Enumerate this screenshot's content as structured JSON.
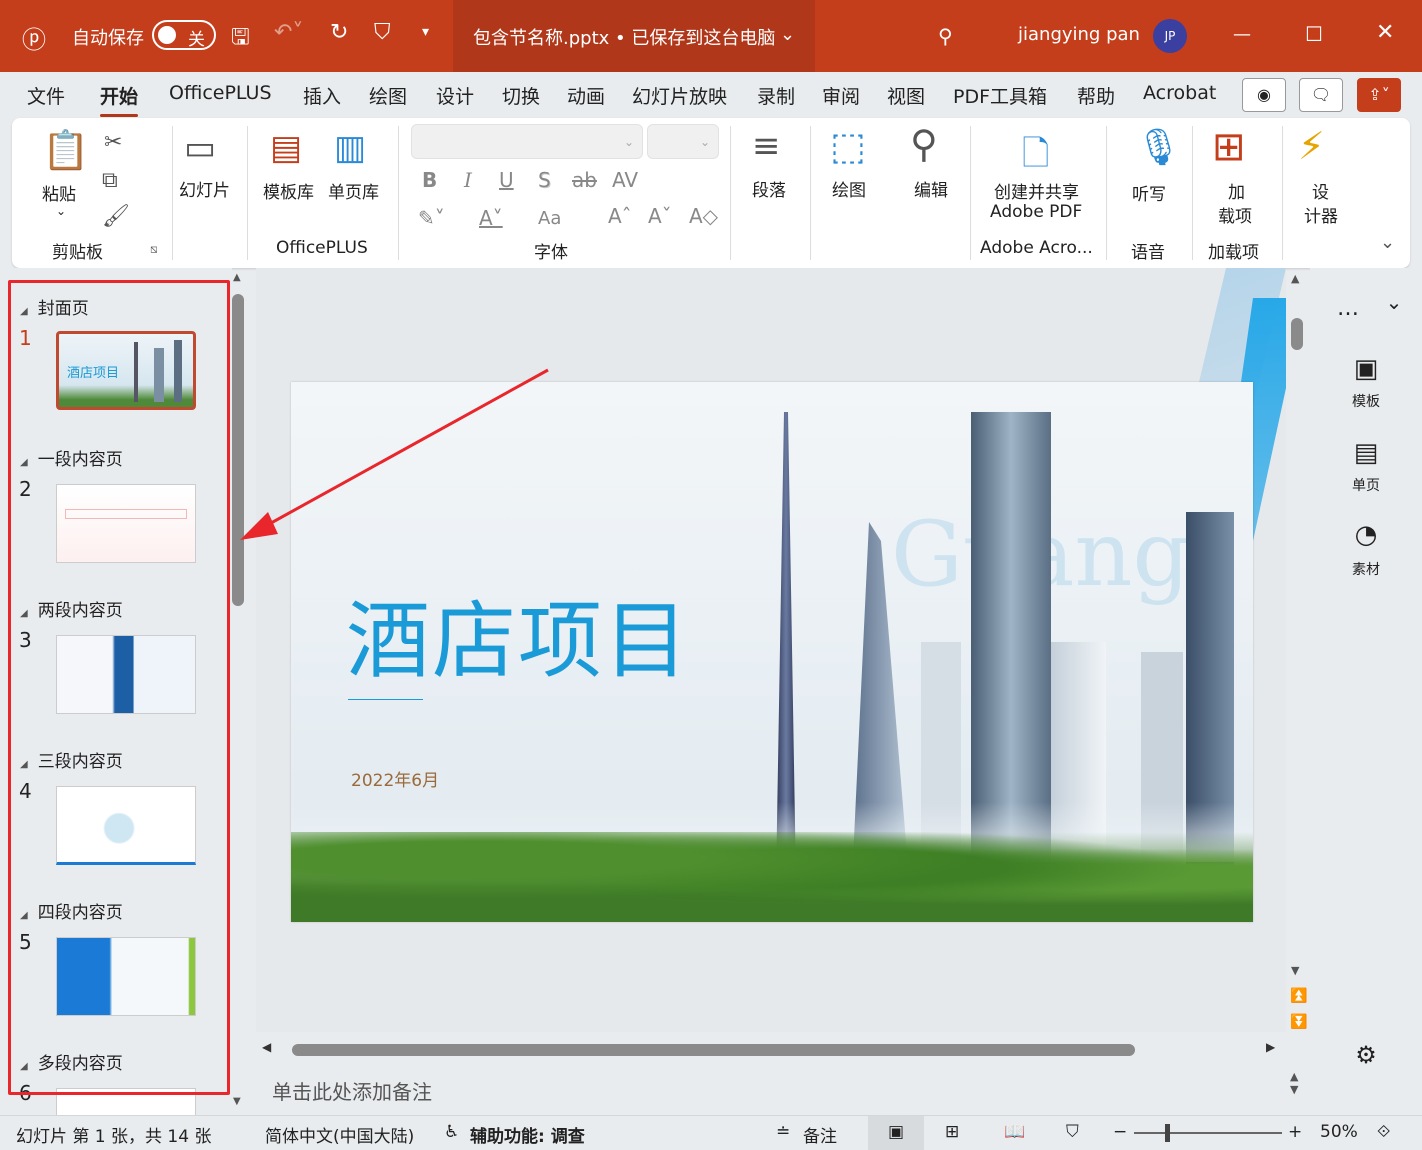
{
  "titlebar": {
    "autosave_label": "自动保存",
    "autosave_state": "关",
    "document_title": "包含节名称.pptx • 已保存到这台电脑",
    "user_name": "jiangying pan",
    "user_initials": "JP"
  },
  "tabs": [
    "文件",
    "开始",
    "OfficePLUS",
    "插入",
    "绘图",
    "设计",
    "切换",
    "动画",
    "幻灯片放映",
    "录制",
    "审阅",
    "视图",
    "PDF工具箱",
    "帮助",
    "Acrobat"
  ],
  "ribbon": {
    "clipboard": {
      "paste": "粘贴",
      "group": "剪贴板"
    },
    "slides": {
      "slide": "幻灯片"
    },
    "officeplus": {
      "template_lib": "模板库",
      "page_lib": "单页库",
      "group": "OfficePLUS"
    },
    "font": {
      "group": "字体",
      "bold": "B",
      "italic": "I",
      "underline": "U",
      "shadow": "S",
      "strike": "ab",
      "spacing": "AV",
      "case": "Aa"
    },
    "paragraph": {
      "label": "段落"
    },
    "drawing": {
      "label": "绘图"
    },
    "editing": {
      "label": "编辑"
    },
    "adobe": {
      "label1": "创建并共享",
      "label2": "Adobe PDF",
      "group": "Adobe Acro..."
    },
    "voice": {
      "label": "听写",
      "group": "语音"
    },
    "addins": {
      "label1": "加",
      "label2": "载项",
      "group": "加载项"
    },
    "designer": {
      "label1": "设",
      "label2": "计器"
    }
  },
  "sections": [
    {
      "name": "封面页",
      "slide": "1",
      "thumb_text": "酒店项目"
    },
    {
      "name": "一段内容页",
      "slide": "2"
    },
    {
      "name": "两段内容页",
      "slide": "3"
    },
    {
      "name": "三段内容页",
      "slide": "4"
    },
    {
      "name": "四段内容页",
      "slide": "5"
    },
    {
      "name": "多段内容页",
      "slide": "6"
    }
  ],
  "slide": {
    "title": "酒店项目",
    "date": "2022年6月",
    "watermark": "Guang"
  },
  "right_pane": {
    "template": "模板",
    "single_page": "单页",
    "material": "素材"
  },
  "notes_placeholder": "单击此处添加备注",
  "status": {
    "slide_info": "幻灯片 第 1 张，共 14 张",
    "language": "简体中文(中国大陆)",
    "accessibility": "辅助功能: 调查",
    "notes": "备注",
    "zoom": "50%"
  },
  "colors": {
    "accent": "#c43e1c",
    "annotation": "#e8262b",
    "slide_title": "#1a9ad6"
  }
}
